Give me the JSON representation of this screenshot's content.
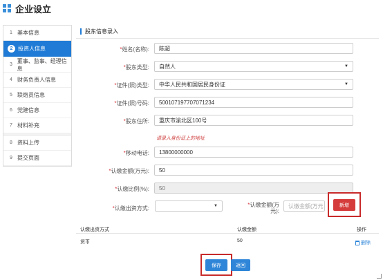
{
  "header": {
    "title": "企业设立"
  },
  "sidebar": {
    "steps": [
      {
        "num": "1",
        "label": "基本信息"
      },
      {
        "num": "2",
        "label": "投资人信息"
      },
      {
        "num": "3",
        "label": "董事、监事、经理信息"
      },
      {
        "num": "4",
        "label": "财务负责人信息"
      },
      {
        "num": "5",
        "label": "联络员信息"
      },
      {
        "num": "6",
        "label": "党建信息"
      },
      {
        "num": "7",
        "label": "材料补充"
      },
      {
        "num": "8",
        "label": "资料上传"
      },
      {
        "num": "9",
        "label": "提交页面"
      }
    ]
  },
  "form": {
    "section_title": "股东信息录入",
    "name": {
      "label": "姓名(名称):",
      "value": "陈超"
    },
    "type": {
      "label": "股东类型:",
      "value": "自然人"
    },
    "id_type": {
      "label": "证件(照)类型:",
      "value": "中华人民共和国居民身份证"
    },
    "id_number": {
      "label": "证件(照)号码:",
      "value": "500107197707071234"
    },
    "address": {
      "label": "股东住所:",
      "value": "重庆市渝北区100号"
    },
    "address_hint": "请录入身份证上的地址",
    "mobile": {
      "label": "移动电话:",
      "value": "13800000000"
    },
    "subscribed_amount": {
      "label": "认缴金额(万元):",
      "value": "50"
    },
    "subscribed_ratio": {
      "label": "认缴比例(%):",
      "value": "50"
    },
    "contribution_method": {
      "label": "认缴出资方式:",
      "value": ""
    },
    "method_amount": {
      "label_line1": "认缴金额(万",
      "label_line2": "元):",
      "placeholder": "认缴金额(万元"
    },
    "add_button": "新增"
  },
  "table": {
    "headers": {
      "method": "认缴出资方式",
      "amount": "认缴金额",
      "action": "操作"
    },
    "rows": [
      {
        "method": "货币",
        "amount": "50",
        "action": "删除"
      }
    ]
  },
  "actions": {
    "save": "保存",
    "back": "返回"
  },
  "colors": {
    "accent": "#1f7bd6",
    "danger": "#d63b3b",
    "highlight_box": "#c82a2a"
  }
}
